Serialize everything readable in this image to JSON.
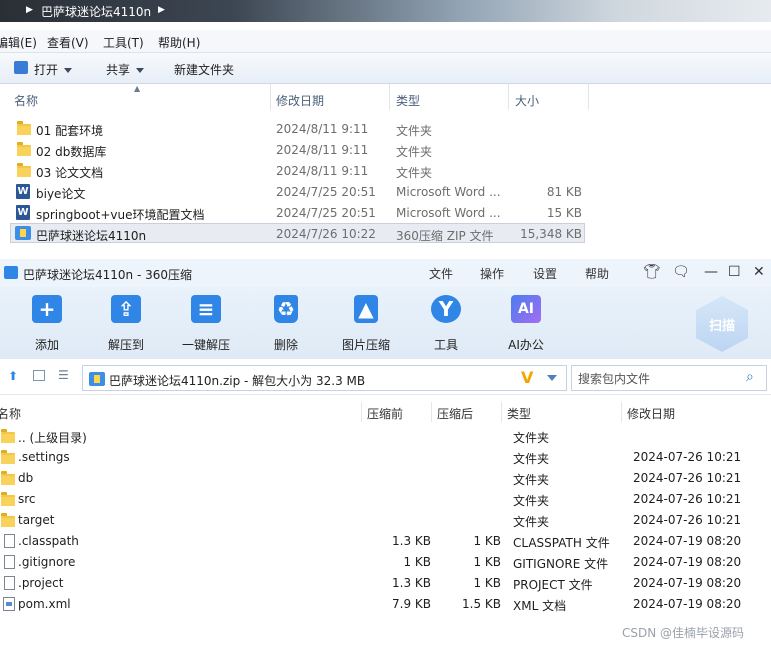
{
  "explorer": {
    "breadcrumb": "巴萨球迷论坛4110n",
    "menu": [
      "编辑(E)",
      "查看(V)",
      "工具(T)",
      "帮助(H)"
    ],
    "toolbar": {
      "open": "打开",
      "share": "共享",
      "new_folder": "新建文件夹"
    },
    "columns": {
      "name": "名称",
      "date": "修改日期",
      "type": "类型",
      "size": "大小"
    },
    "files": [
      {
        "name": "01 配套环境",
        "date": "2024/8/11 9:11",
        "type": "文件夹",
        "size": "",
        "icon": "folder-icon"
      },
      {
        "name": "02 db数据库",
        "date": "2024/8/11 9:11",
        "type": "文件夹",
        "size": "",
        "icon": "folder-icon"
      },
      {
        "name": "03 论文文档",
        "date": "2024/8/11 9:11",
        "type": "文件夹",
        "size": "",
        "icon": "folder-icon"
      },
      {
        "name": "biye论文",
        "date": "2024/7/25 20:51",
        "type": "Microsoft Word ...",
        "size": "81 KB",
        "icon": "word-document-icon"
      },
      {
        "name": "springboot+vue环境配置文档",
        "date": "2024/7/25 20:51",
        "type": "Microsoft Word ...",
        "size": "15 KB",
        "icon": "word-document-icon"
      },
      {
        "name": "巴萨球迷论坛4110n",
        "date": "2024/7/26 10:22",
        "type": "360压缩 ZIP 文件",
        "size": "15,348 KB",
        "icon": "zip-archive-icon"
      }
    ]
  },
  "zip360": {
    "title": "巴萨球迷论坛4110n - 360压缩",
    "menu": [
      "文件",
      "操作",
      "设置",
      "帮助"
    ],
    "tools": [
      "添加",
      "解压到",
      "一键解压",
      "删除",
      "图片压缩",
      "工具",
      "AI办公"
    ],
    "scan_label": "扫描",
    "path_text": "巴萨球迷论坛4110n.zip - 解包大小为 32.3 MB",
    "search_placeholder": "搜索包内文件",
    "columns": {
      "name": "名称",
      "compressed_before": "压缩前",
      "compressed_after": "压缩后",
      "type": "类型",
      "date": "修改日期"
    },
    "files": [
      {
        "name": ".. (上级目录)",
        "before": "",
        "after": "",
        "type": "文件夹",
        "date": "",
        "icon": "folder-icon"
      },
      {
        "name": ".settings",
        "before": "",
        "after": "",
        "type": "文件夹",
        "date": "2024-07-26 10:21",
        "icon": "folder-icon"
      },
      {
        "name": "db",
        "before": "",
        "after": "",
        "type": "文件夹",
        "date": "2024-07-26 10:21",
        "icon": "folder-icon"
      },
      {
        "name": "src",
        "before": "",
        "after": "",
        "type": "文件夹",
        "date": "2024-07-26 10:21",
        "icon": "folder-icon"
      },
      {
        "name": "target",
        "before": "",
        "after": "",
        "type": "文件夹",
        "date": "2024-07-26 10:21",
        "icon": "folder-icon"
      },
      {
        "name": ".classpath",
        "before": "1.3 KB",
        "after": "1 KB",
        "type": "CLASSPATH 文件",
        "date": "2024-07-19 08:20",
        "icon": "file-icon"
      },
      {
        "name": ".gitignore",
        "before": "1 KB",
        "after": "1 KB",
        "type": "GITIGNORE 文件",
        "date": "2024-07-19 08:20",
        "icon": "file-icon"
      },
      {
        "name": ".project",
        "before": "1.3 KB",
        "after": "1 KB",
        "type": "PROJECT 文件",
        "date": "2024-07-19 08:20",
        "icon": "file-icon"
      },
      {
        "name": "pom.xml",
        "before": "7.9 KB",
        "after": "1.5 KB",
        "type": "XML 文档",
        "date": "2024-07-19 08:20",
        "icon": "xml-file-icon"
      }
    ]
  },
  "watermark": "CSDN @佳楠毕设源码",
  "colors": {
    "accent": "#2f86e6",
    "folder": "#f3c742",
    "highlight": "#f5a400"
  }
}
